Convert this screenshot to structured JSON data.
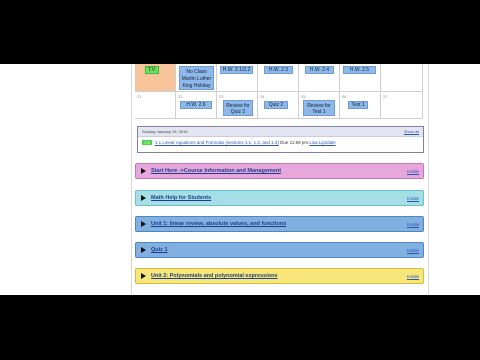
{
  "calendar": {
    "row1": [
      {
        "day": "",
        "highlight": true,
        "events": [
          {
            "text": "T.V.",
            "color": "green"
          }
        ]
      },
      {
        "day": "",
        "events": [
          {
            "text": "No Class Martin Luther King Holiday",
            "color": "blue"
          }
        ]
      },
      {
        "day": "",
        "events": [
          {
            "text": "H.W. 2.1/2.2",
            "color": "blue"
          }
        ]
      },
      {
        "day": "",
        "events": [
          {
            "text": "H.W. 2.3",
            "color": "blue"
          }
        ]
      },
      {
        "day": "",
        "events": [
          {
            "text": "H.W. 2.4",
            "color": "blue"
          }
        ]
      },
      {
        "day": "",
        "events": [
          {
            "text": "H.W. 2.5",
            "color": "blue"
          }
        ]
      },
      {
        "day": "",
        "events": []
      }
    ],
    "row2": [
      {
        "day": "21",
        "events": []
      },
      {
        "day": "22",
        "events": [
          {
            "text": "H.W. 2.6",
            "color": "blue"
          }
        ]
      },
      {
        "day": "23",
        "events": [
          {
            "text": "Review for Quiz 2",
            "color": "blue"
          }
        ]
      },
      {
        "day": "24",
        "events": [
          {
            "text": "Quiz 2",
            "color": "blue"
          }
        ]
      },
      {
        "day": "25",
        "events": [
          {
            "text": "Review for Test 1",
            "color": "blue"
          }
        ]
      },
      {
        "day": "26",
        "events": [
          {
            "text": "Test 1",
            "color": "blue"
          }
        ]
      },
      {
        "day": "27",
        "events": []
      }
    ]
  },
  "announcement": {
    "date": "Sunday January 15, 2016",
    "show_all": "Show all",
    "badge": "1.5",
    "link": "1.1 Linear equations and Formulas (sections 1.1, 1.2, and 1.3)",
    "due": "Due 11:59 pm",
    "teacher": "Lisa Lipsdale"
  },
  "folders": [
    {
      "label": "Start Here ->Course Information and Management",
      "edit": "Inside",
      "color": "pink"
    },
    {
      "label": "Math Help for Students",
      "edit": "Inside",
      "color": "teal"
    },
    {
      "label": "Unit 1: linear review, absolute values, and functions",
      "edit": "Inside",
      "color": "blue"
    },
    {
      "label": "Quiz 1",
      "edit": "Inside",
      "color": "blue"
    },
    {
      "label": "Unit 2: Polynomials and polynomial expressions",
      "edit": "Inside",
      "color": "yellow"
    }
  ]
}
